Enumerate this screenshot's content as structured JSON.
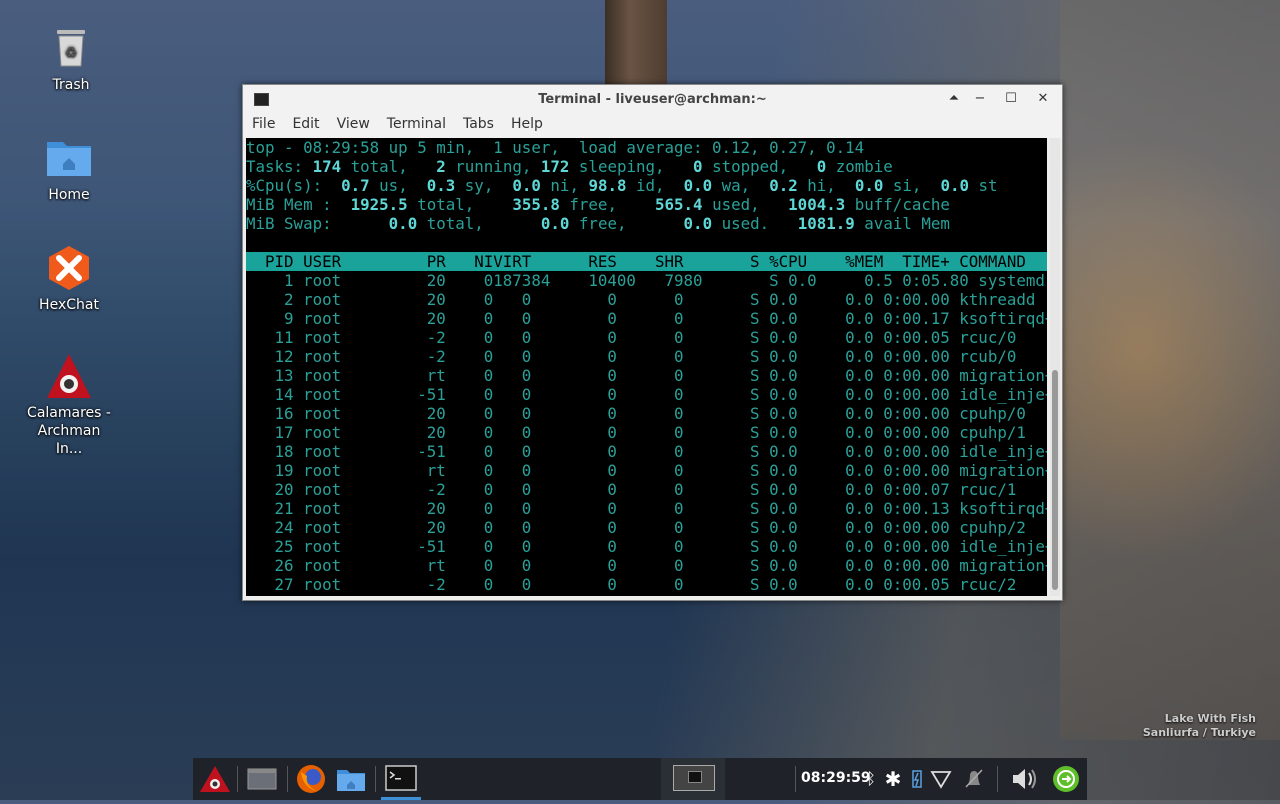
{
  "desktop": {
    "icons": [
      {
        "label": "Trash"
      },
      {
        "label": "Home"
      },
      {
        "label": "HexChat"
      },
      {
        "label": "Calamares - Archman In..."
      }
    ],
    "wallpaper_caption": {
      "line1": "Lake With Fish",
      "line2": "Sanliurfa / Turkiye"
    }
  },
  "window": {
    "title": "Terminal - liveuser@archman:~",
    "menu": [
      "File",
      "Edit",
      "View",
      "Terminal",
      "Tabs",
      "Help"
    ],
    "controls": {
      "shade": "⏶",
      "minimize": "−",
      "maximize": "☐",
      "close": "✕"
    }
  },
  "top": {
    "summary": {
      "line1": "top - 08:29:58 up 5 min,  1 user,  load average: 0.12, 0.27, 0.14",
      "tasks": {
        "prefix": "Tasks: ",
        "total": "174",
        "t_total": " total,   ",
        "running": "2",
        "t_running": " running, ",
        "sleeping": "172",
        "t_sleeping": " sleeping,   ",
        "stopped": "0",
        "t_stopped": " stopped,   ",
        "zombie": "0",
        "t_zombie": " zombie"
      },
      "cpu": {
        "prefix": "%Cpu(s):  ",
        "us": "0.7",
        "t_us": " us,  ",
        "sy": "0.3",
        "t_sy": " sy,  ",
        "ni": "0.0",
        "t_ni": " ni, ",
        "id": "98.8",
        "t_id": " id,  ",
        "wa": "0.0",
        "t_wa": " wa,  ",
        "hi": "0.2",
        "t_hi": " hi,  ",
        "si": "0.0",
        "t_si": " si,  ",
        "st": "0.0",
        "t_st": " st"
      },
      "mem": {
        "prefix": "MiB Mem :  ",
        "total": "1925.5",
        "t_total": " total,    ",
        "free": "355.8",
        "t_free": " free,    ",
        "used": "565.4",
        "t_used": " used,   ",
        "cache": "1004.3",
        "t_cache": " buff/cache"
      },
      "swap": {
        "prefix": "MiB Swap:      ",
        "total": "0.0",
        "t_total": " total,      ",
        "free": "0.0",
        "t_free": " free,      ",
        "used": "0.0",
        "t_used": " used.   ",
        "avail": "1081.9",
        "t_avail": " avail Mem"
      }
    },
    "columns": [
      "PID",
      "USER",
      "PR",
      "NI",
      "VIRT",
      "RES",
      "SHR",
      "S",
      "%CPU",
      "%MEM",
      "TIME+",
      "COMMAND"
    ],
    "processes": [
      [
        "1",
        "root",
        "20",
        "0",
        "187384",
        "10400",
        "7980",
        "S",
        "0.0",
        "0.5",
        "0:05.80",
        "systemd"
      ],
      [
        "2",
        "root",
        "20",
        "0",
        "0",
        "0",
        "0",
        "S",
        "0.0",
        "0.0",
        "0:00.00",
        "kthreadd"
      ],
      [
        "9",
        "root",
        "20",
        "0",
        "0",
        "0",
        "0",
        "S",
        "0.0",
        "0.0",
        "0:00.17",
        "ksoftirqd+"
      ],
      [
        "11",
        "root",
        "-2",
        "0",
        "0",
        "0",
        "0",
        "S",
        "0.0",
        "0.0",
        "0:00.05",
        "rcuc/0"
      ],
      [
        "12",
        "root",
        "-2",
        "0",
        "0",
        "0",
        "0",
        "S",
        "0.0",
        "0.0",
        "0:00.00",
        "rcub/0"
      ],
      [
        "13",
        "root",
        "rt",
        "0",
        "0",
        "0",
        "0",
        "S",
        "0.0",
        "0.0",
        "0:00.00",
        "migration+"
      ],
      [
        "14",
        "root",
        "-51",
        "0",
        "0",
        "0",
        "0",
        "S",
        "0.0",
        "0.0",
        "0:00.00",
        "idle_inje+"
      ],
      [
        "16",
        "root",
        "20",
        "0",
        "0",
        "0",
        "0",
        "S",
        "0.0",
        "0.0",
        "0:00.00",
        "cpuhp/0"
      ],
      [
        "17",
        "root",
        "20",
        "0",
        "0",
        "0",
        "0",
        "S",
        "0.0",
        "0.0",
        "0:00.00",
        "cpuhp/1"
      ],
      [
        "18",
        "root",
        "-51",
        "0",
        "0",
        "0",
        "0",
        "S",
        "0.0",
        "0.0",
        "0:00.00",
        "idle_inje+"
      ],
      [
        "19",
        "root",
        "rt",
        "0",
        "0",
        "0",
        "0",
        "S",
        "0.0",
        "0.0",
        "0:00.00",
        "migration+"
      ],
      [
        "20",
        "root",
        "-2",
        "0",
        "0",
        "0",
        "0",
        "S",
        "0.0",
        "0.0",
        "0:00.07",
        "rcuc/1"
      ],
      [
        "21",
        "root",
        "20",
        "0",
        "0",
        "0",
        "0",
        "S",
        "0.0",
        "0.0",
        "0:00.13",
        "ksoftirqd+"
      ],
      [
        "24",
        "root",
        "20",
        "0",
        "0",
        "0",
        "0",
        "S",
        "0.0",
        "0.0",
        "0:00.00",
        "cpuhp/2"
      ],
      [
        "25",
        "root",
        "-51",
        "0",
        "0",
        "0",
        "0",
        "S",
        "0.0",
        "0.0",
        "0:00.00",
        "idle_inje+"
      ],
      [
        "26",
        "root",
        "rt",
        "0",
        "0",
        "0",
        "0",
        "S",
        "0.0",
        "0.0",
        "0:00.00",
        "migration+"
      ],
      [
        "27",
        "root",
        "-2",
        "0",
        "0",
        "0",
        "0",
        "S",
        "0.0",
        "0.0",
        "0:00.05",
        "rcuc/2"
      ]
    ]
  },
  "taskbar": {
    "clock": "08:29:59",
    "icons": [
      "archman-menu-icon",
      "show-desktop-icon",
      "firefox-icon",
      "file-manager-icon",
      "terminal-icon",
      "bluetooth-icon",
      "settings-icon",
      "battery-icon",
      "wifi-icon",
      "notifications-muted-icon",
      "volume-icon",
      "logout-icon"
    ],
    "colors": {
      "firefox": "#e66000",
      "logout": "#5fbf2a",
      "accent_underline": "#3d8fd6"
    }
  }
}
